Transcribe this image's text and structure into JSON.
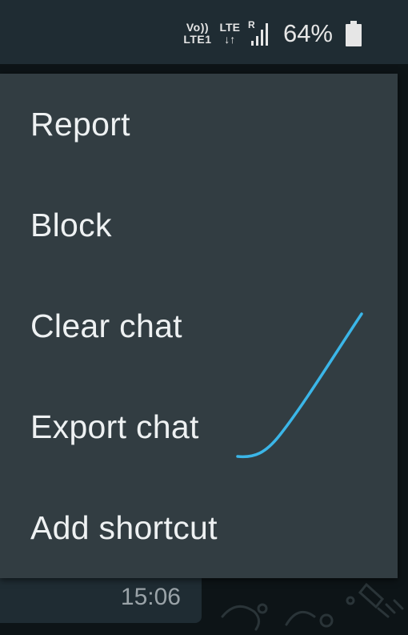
{
  "status_bar": {
    "volte_top": "Vo))",
    "volte_bottom": "LTE1",
    "lte_label": "LTE",
    "lte_arrows": "↓↑",
    "roaming": "R",
    "battery_percent": "64%",
    "battery_level": 0.64
  },
  "menu": {
    "items": [
      {
        "label": "Report"
      },
      {
        "label": "Block"
      },
      {
        "label": "Clear chat"
      },
      {
        "label": "Export chat"
      },
      {
        "label": "Add shortcut"
      }
    ]
  },
  "chat": {
    "message_time": "15:06"
  },
  "colors": {
    "menu_bg": "#323d42",
    "status_bar_bg": "#1f2c33",
    "scribble": "#3bb6e8"
  }
}
